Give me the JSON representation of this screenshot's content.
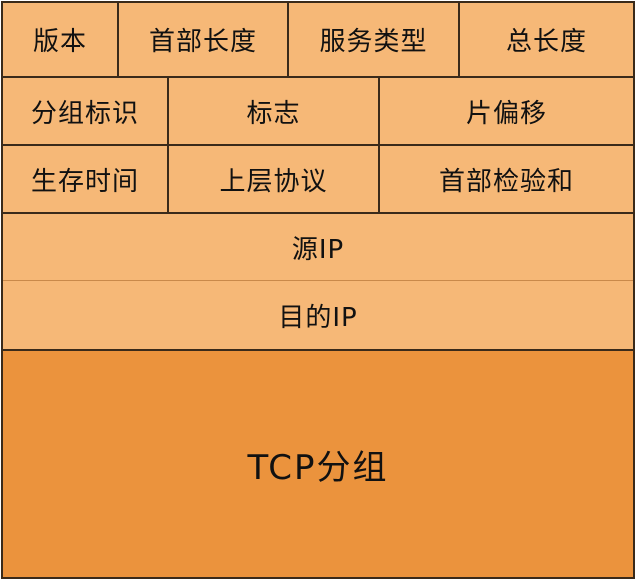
{
  "diagram": {
    "rows": [
      {
        "cells": [
          "版本",
          "首部长度",
          "服务类型",
          "总长度"
        ]
      },
      {
        "cells": [
          "分组标识",
          "标志",
          "片偏移"
        ]
      },
      {
        "cells": [
          "生存时间",
          "上层协议",
          "首部检验和"
        ]
      },
      {
        "cells": [
          "源IP"
        ]
      },
      {
        "cells": [
          "目的IP"
        ]
      }
    ],
    "payload": "TCP分组",
    "colors": {
      "header": "#f6b877",
      "payload": "#eb933d",
      "border": "#3a2a1a"
    }
  }
}
